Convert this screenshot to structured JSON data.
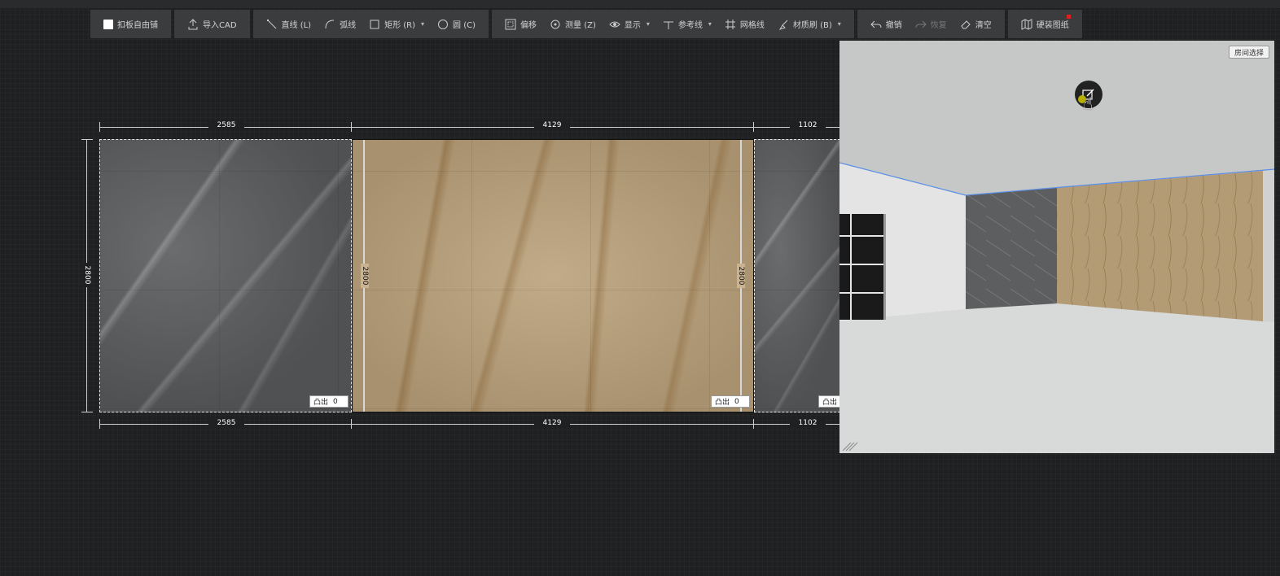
{
  "toolbar": {
    "groups": [
      [
        {
          "label": "扣板自由铺",
          "icon": "checkbox",
          "caret": false
        }
      ],
      [
        {
          "label": "导入CAD",
          "icon": "upload-icon",
          "caret": false
        }
      ],
      [
        {
          "label": "直线 (L)",
          "icon": "line-icon",
          "caret": false
        },
        {
          "label": "弧线",
          "icon": "arc-icon",
          "caret": false
        },
        {
          "label": "矩形 (R)",
          "icon": "rect-icon",
          "caret": true
        },
        {
          "label": "圆 (C)",
          "icon": "circle-icon",
          "caret": false
        }
      ],
      [
        {
          "label": "偏移",
          "icon": "offset-icon",
          "caret": false
        },
        {
          "label": "测量 (Z)",
          "icon": "measure-icon",
          "caret": false
        },
        {
          "label": "显示",
          "icon": "eye-icon",
          "caret": true
        },
        {
          "label": "参考线",
          "icon": "guide-icon",
          "caret": true
        },
        {
          "label": "网格线",
          "icon": "grid-icon",
          "caret": false
        },
        {
          "label": "材质刷 (B)",
          "icon": "brush-icon",
          "caret": true
        }
      ],
      [
        {
          "label": "撤销",
          "icon": "undo-icon",
          "caret": false
        },
        {
          "label": "恢复",
          "icon": "redo-icon",
          "caret": false,
          "disabled": true
        },
        {
          "label": "清空",
          "icon": "eraser-icon",
          "caret": false
        }
      ],
      [
        {
          "label": "硬装图纸",
          "icon": "map-icon",
          "caret": false,
          "badge": true
        }
      ]
    ]
  },
  "canvas": {
    "top_dims": [
      "2585",
      "4129",
      "1102"
    ],
    "bottom_dims": [
      "2585",
      "4129",
      "1102"
    ],
    "left_height": "2800",
    "inner_height_left": "2800",
    "inner_height_right": "2800",
    "tu_label": "凸出",
    "tu_values": [
      "0",
      "0",
      ""
    ]
  },
  "preview": {
    "room_select_label": "房间选择"
  }
}
